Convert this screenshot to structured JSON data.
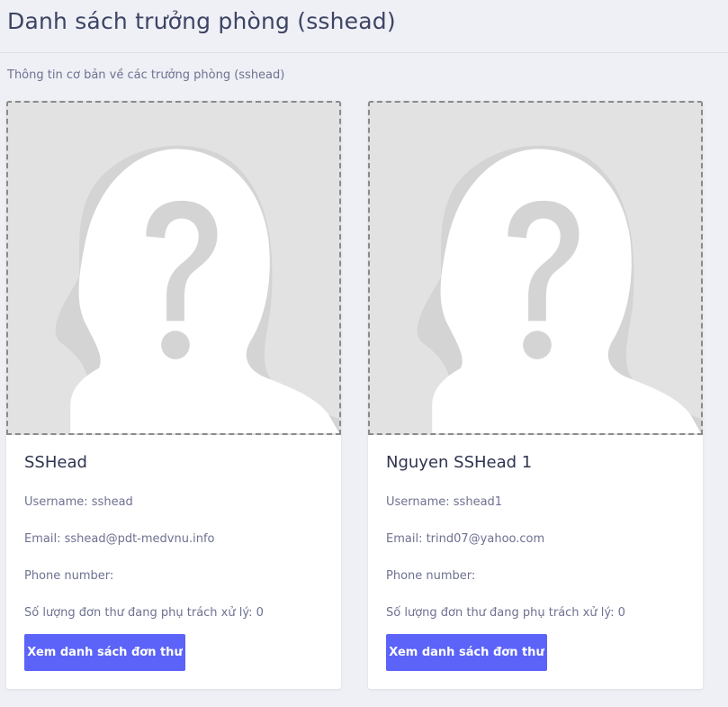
{
  "page": {
    "title": "Danh sách trưởng phòng (sshead)",
    "subtitle": "Thông tin cơ bản về các trưởng phòng (sshead)"
  },
  "colors": {
    "background": "#eff0f5",
    "card": "#ffffff",
    "button": "#5b63f8",
    "title_text": "#3d4465",
    "muted_text": "#6e7191"
  },
  "cards": [
    {
      "avatar_icon": "unknown-person-placeholder-icon",
      "name": "SSHead",
      "username": "Username: sshead",
      "email": "Email: sshead@pdt-medvnu.info",
      "phone": "Phone number:",
      "count": "Số lượng đơn thư đang phụ trách xử lý: 0",
      "button_label": "Xem danh sách đơn thư"
    },
    {
      "avatar_icon": "unknown-person-placeholder-icon",
      "name": "Nguyen SSHead 1",
      "username": "Username: sshead1",
      "email": "Email: trind07@yahoo.com",
      "phone": "Phone number:",
      "count": "Số lượng đơn thư đang phụ trách xử lý: 0",
      "button_label": "Xem danh sách đơn thư"
    }
  ]
}
